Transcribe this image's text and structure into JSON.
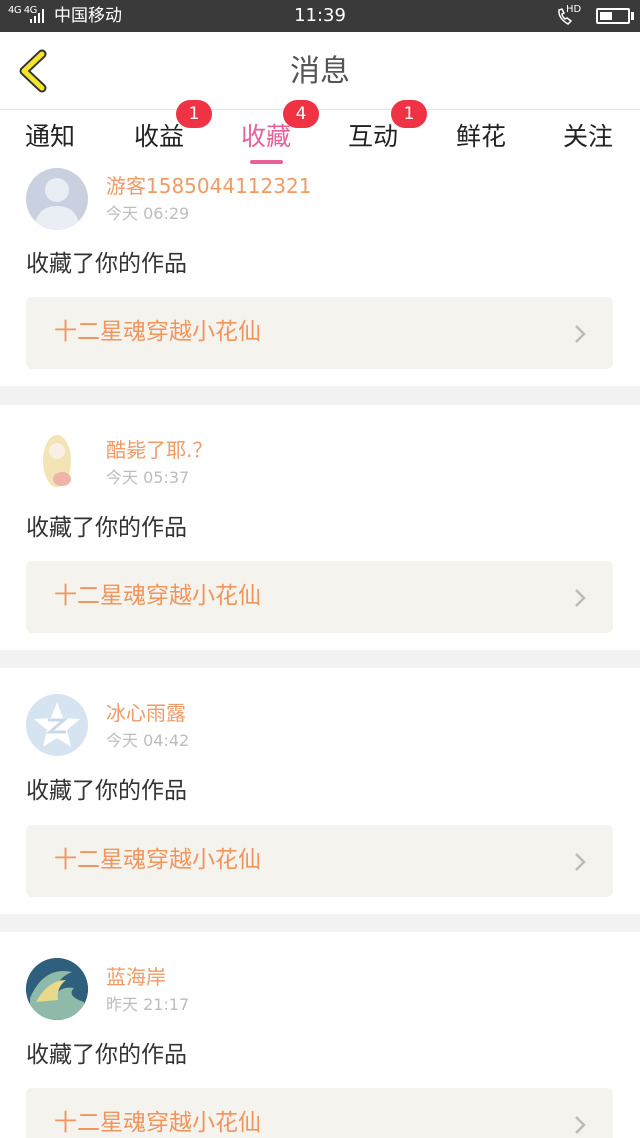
{
  "status_bar": {
    "network": "4G 4G",
    "carrier": "中国移动",
    "time": "11:39",
    "hd": "HD",
    "battery_level": 0.45
  },
  "header": {
    "title": "消息"
  },
  "tabs": [
    {
      "label": "通知",
      "badge": ""
    },
    {
      "label": "收益",
      "badge": "1"
    },
    {
      "label": "收藏",
      "badge": "4"
    },
    {
      "label": "互动",
      "badge": "1"
    },
    {
      "label": "鲜花",
      "badge": ""
    },
    {
      "label": "关注",
      "badge": ""
    }
  ],
  "active_tab": "收藏",
  "colors": {
    "accent": "#e8609a",
    "badge": "#f03344",
    "username": "#f09a66",
    "work_title": "#f0955c"
  },
  "items": [
    {
      "user": "游客1585044112321",
      "time": "今天 06:29",
      "action": "收藏了你的作品",
      "work": "十二星魂穿越小花仙",
      "avatar": "default-person-avatar"
    },
    {
      "user": "酷毙了耶.？",
      "time": "今天 05:37",
      "action": "收藏了你的作品",
      "work": "十二星魂穿越小花仙",
      "avatar": "anime-girl-avatar"
    },
    {
      "user": "冰心雨露",
      "time": "今天 04:42",
      "action": "收藏了你的作品",
      "work": "十二星魂穿越小花仙",
      "avatar": "qzone-avatar"
    },
    {
      "user": "蓝海岸",
      "time": "昨天 21:17",
      "action": "收藏了你的作品",
      "work": "十二星魂穿越小花仙",
      "avatar": "ocean-wave-avatar"
    }
  ]
}
